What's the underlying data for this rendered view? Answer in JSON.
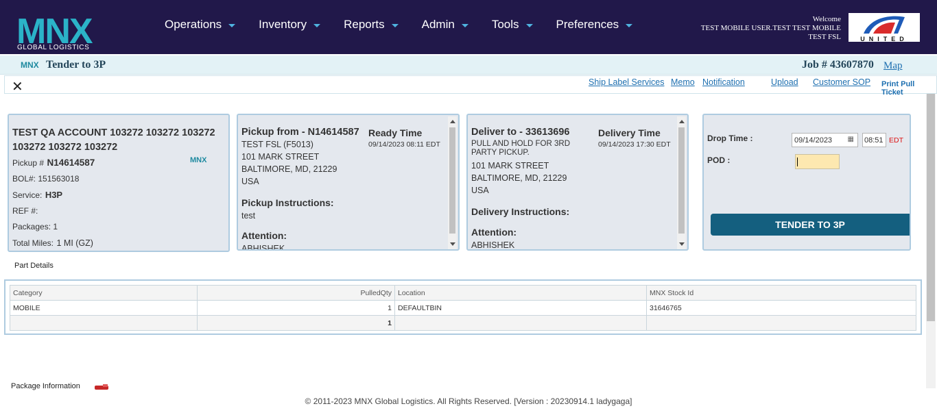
{
  "nav": {
    "logo_text": "MNX",
    "logo_sub": "GLOBAL LOGISTICS",
    "menu": [
      "Operations",
      "Inventory",
      "Reports",
      "Admin",
      "Tools",
      "Preferences"
    ],
    "welcome": "Welcome",
    "user": "TEST MOBILE USER.TEST TEST MOBILE",
    "location": "TEST FSL",
    "partner_logo_text": "UNITED"
  },
  "subheader": {
    "logo": "MNX",
    "title": "Tender to 3P",
    "job": "Job # 43607870",
    "map": "Map"
  },
  "toolbar": {
    "close": "✕",
    "links": [
      "Ship Label Services",
      "Memo",
      "Notification",
      "Upload",
      "Customer SOP"
    ],
    "print": "Print Pull Ticket"
  },
  "account": {
    "name": "TEST QA ACCOUNT 103272 103272 103272 103272 103272 103272",
    "pickup_label": "Pickup #",
    "pickup_value": "N14614587",
    "carrier_logo": "MNX",
    "bol": "BOL#: 151563018",
    "service_label": "Service:",
    "service_value": "H3P",
    "ref": "REF #:",
    "packages": "Packages: 1",
    "miles_label": "Total Miles:",
    "miles_value": "1 MI (GZ)"
  },
  "pickup": {
    "title": "Pickup from - N14614587",
    "ready_label": "Ready Time",
    "ready_value": "09/14/2023 08:11 EDT",
    "line1": "TEST FSL (F5013)",
    "line2": "101 MARK STREET",
    "line3": "BALTIMORE, MD, 21229",
    "line4": "USA",
    "instr_label": "Pickup Instructions:",
    "instr_value": "test",
    "attn_label": "Attention:",
    "attn_value": "ABHISHEK"
  },
  "deliver": {
    "title": "Deliver to - 33613696",
    "time_label": "Delivery Time",
    "time_value": "09/14/2023 17:30 EDT",
    "line1": "PULL AND HOLD FOR 3RD PARTY PICKUP.",
    "line2": "101 MARK STREET",
    "line3": "BALTIMORE, MD, 21229",
    "line4": "USA",
    "instr_label": "Delivery Instructions:",
    "attn_label": "Attention:",
    "attn_value": "ABHISHEK"
  },
  "tender": {
    "drop_label": "Drop Time :",
    "date_value": "09/14/2023",
    "time_value": "08:51",
    "tz": "EDT",
    "pod_label": "POD :",
    "pod_value": "",
    "button": "TENDER TO 3P"
  },
  "parts": {
    "title": "Part Details",
    "headers": [
      "Category",
      "PulledQty",
      "Location",
      "MNX Stock Id"
    ],
    "row": [
      "MOBILE",
      "1",
      "DEFAULTBIN",
      "31646765"
    ],
    "total": "1"
  },
  "package": {
    "title": "Package Information"
  },
  "footer": "© 2011-2023 MNX Global Logistics. All Rights Reserved. [Version : 20230914.1 ladygaga]",
  "colors": {
    "nav_bg": "#21184a",
    "accent": "#1f8aa0",
    "button": "#145f7f"
  }
}
